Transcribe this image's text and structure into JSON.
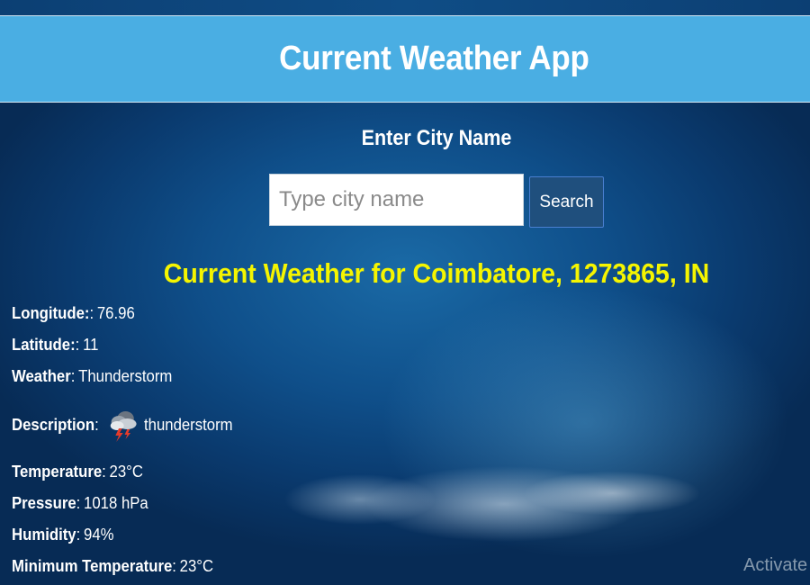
{
  "header": {
    "title": "Current Weather App"
  },
  "search": {
    "label": "Enter City Name",
    "placeholder": "Type city name",
    "value": "",
    "button_label": "Search"
  },
  "result": {
    "title": "Current Weather for Coimbatore, 1273865, IN",
    "fields": {
      "longitude": {
        "label": "Longitude:",
        "sep": ":",
        "value": "76.96"
      },
      "latitude": {
        "label": "Latitude:",
        "sep": ":",
        "value": "11"
      },
      "weather": {
        "label": "Weather",
        "sep": ":",
        "value": "Thunderstorm"
      },
      "description": {
        "label": "Description",
        "sep": ":",
        "value": "thunderstorm",
        "icon": "thunderstorm-icon"
      },
      "temperature": {
        "label": "Temperature",
        "sep": ":",
        "value": "23°C"
      },
      "pressure": {
        "label": "Pressure",
        "sep": ":",
        "value": "1018 hPa"
      },
      "humidity": {
        "label": "Humidity",
        "sep": ":",
        "value": "94%"
      },
      "min_temperature": {
        "label": "Minimum Temperature",
        "sep": ":",
        "value": "23°C"
      }
    }
  },
  "watermark": {
    "text": "Activate W"
  },
  "colors": {
    "header_bg": "#4aaee3",
    "title_yellow": "#f5f500",
    "button_bg": "#1f4f7d"
  }
}
